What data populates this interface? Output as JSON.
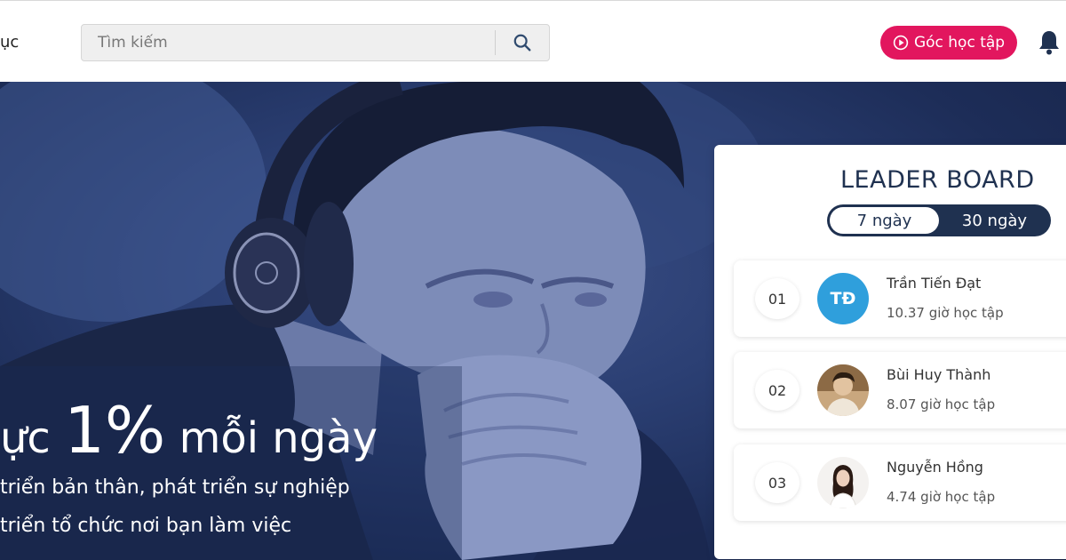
{
  "header": {
    "nav_fragment": "ục",
    "search": {
      "placeholder": "Tìm kiếm"
    },
    "corner_button": "Góc học tập"
  },
  "hero": {
    "title_prefix": "ực ",
    "title_big": "1%",
    "title_suffix": " mỗi ngày",
    "line1": "triển bản thân, phát triển sự nghiệp",
    "line2": "triển tổ chức nơi bạn làm việc"
  },
  "leaderboard": {
    "title": "LEADER BOARD",
    "tabs": [
      "7 ngày",
      "30 ngày"
    ],
    "active_tab": "7 ngày",
    "entries": [
      {
        "rank": "01",
        "initials": "TĐ",
        "name": "Trần Tiến Đạt",
        "hours": "10.37 giờ học tập",
        "avatar": "initials-avatar"
      },
      {
        "rank": "02",
        "name": "Bùi Huy Thành",
        "hours": "8.07 giờ học tập",
        "avatar": "photo-avatar"
      },
      {
        "rank": "03",
        "name": "Nguyễn Hồng",
        "hours": "4.74 giờ học tập",
        "avatar": "photo-avatar"
      }
    ]
  },
  "colors": {
    "accent": "#e2165e",
    "navy": "#1f3150",
    "hero_bg": "#2b3f73",
    "avatar_blue": "#2f9fdc"
  },
  "icons": [
    "search-icon",
    "play-circle-icon",
    "bell-icon"
  ]
}
